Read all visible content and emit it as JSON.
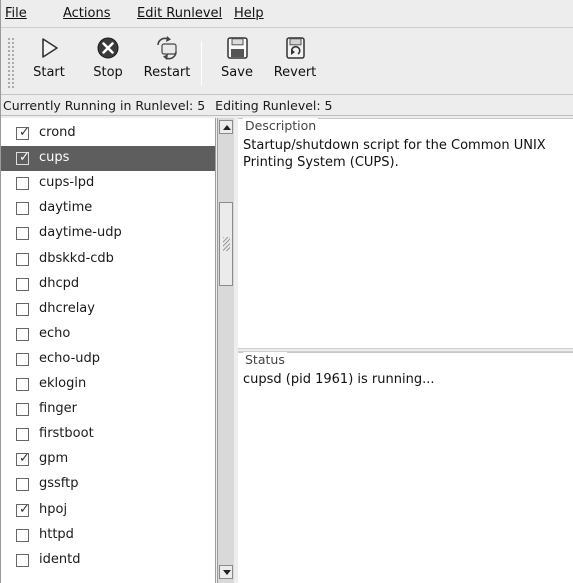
{
  "menubar": {
    "items": [
      {
        "label": "File"
      },
      {
        "label": "Actions"
      },
      {
        "label": "Edit Runlevel"
      },
      {
        "label": "Help"
      }
    ]
  },
  "toolbar": {
    "start_label": "Start",
    "stop_label": "Stop",
    "restart_label": "Restart",
    "save_label": "Save",
    "revert_label": "Revert"
  },
  "runlevel": {
    "running": "Currently Running in Runlevel: 5",
    "editing": "Editing Runlevel: 5"
  },
  "services": [
    {
      "name": "crond",
      "checked": true,
      "selected": false
    },
    {
      "name": "cups",
      "checked": true,
      "selected": true
    },
    {
      "name": "cups-lpd",
      "checked": false,
      "selected": false
    },
    {
      "name": "daytime",
      "checked": false,
      "selected": false
    },
    {
      "name": "daytime-udp",
      "checked": false,
      "selected": false
    },
    {
      "name": "dbskkd-cdb",
      "checked": false,
      "selected": false
    },
    {
      "name": "dhcpd",
      "checked": false,
      "selected": false
    },
    {
      "name": "dhcrelay",
      "checked": false,
      "selected": false
    },
    {
      "name": "echo",
      "checked": false,
      "selected": false
    },
    {
      "name": "echo-udp",
      "checked": false,
      "selected": false
    },
    {
      "name": "eklogin",
      "checked": false,
      "selected": false
    },
    {
      "name": "finger",
      "checked": false,
      "selected": false
    },
    {
      "name": "firstboot",
      "checked": false,
      "selected": false
    },
    {
      "name": "gpm",
      "checked": true,
      "selected": false
    },
    {
      "name": "gssftp",
      "checked": false,
      "selected": false
    },
    {
      "name": "hpoj",
      "checked": true,
      "selected": false
    },
    {
      "name": "httpd",
      "checked": false,
      "selected": false
    },
    {
      "name": "identd",
      "checked": false,
      "selected": false
    }
  ],
  "description": {
    "title": "Description",
    "text": "Startup/shutdown script for the Common UNIX Printing System (CUPS)."
  },
  "status": {
    "title": "Status",
    "text": "cupsd (pid 1961) is running..."
  },
  "icons": {
    "start": "play-icon",
    "stop": "stop-icon",
    "restart": "restart-icon",
    "save": "floppy-disk-icon",
    "revert": "revert-icon"
  },
  "colors": {
    "selection": "#5e5e5e",
    "window": "#ededed"
  }
}
